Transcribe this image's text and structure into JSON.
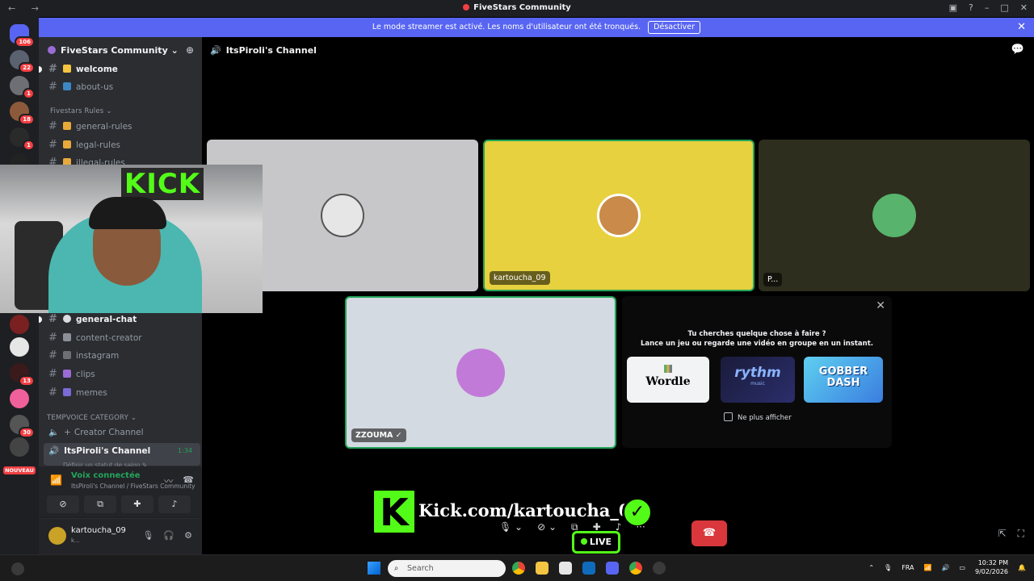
{
  "window": {
    "title": "FiveStars Community",
    "nav_arrows": "← →"
  },
  "banner": {
    "text": "Le mode streamer est activé. Les noms d'utilisateur ont été tronqués.",
    "button": "Désactiver",
    "close": "✕"
  },
  "servers": [
    {
      "badge": "106"
    },
    {
      "badge": "22"
    },
    {
      "badge": "1"
    },
    {
      "badge": "18"
    },
    {
      "badge": "1"
    },
    {
      "badge": "13"
    },
    {
      "badge": "30"
    }
  ],
  "server_new_label": "NOUVEAU",
  "guild": {
    "name": "FiveStars Community ⌄"
  },
  "channels": {
    "welcome": "welcome",
    "about_us": "about-us",
    "rules_category": "Fivestars Rules ⌄",
    "general_rules": "general-rules",
    "legal_rules": "legal-rules",
    "illegal_rules": "illegal-rules",
    "general_chat": "general-chat",
    "content_creator": "content-creator",
    "instagram": "instagram",
    "clips": "clips",
    "memes": "memes",
    "temp_category": "TEMPVOICE CATEGORY ⌄",
    "creator_channel": "Creator Channel",
    "active_voice": "ItsPiroli's Channel",
    "active_timer": "1:34",
    "active_status": "Définir un statut de salon ✎"
  },
  "voice_panel": {
    "status": "Voix connectée",
    "location": "ItsPiroli's Channel / FiveStars Community"
  },
  "user": {
    "name": "kartoucha_09",
    "status": "k..."
  },
  "header": {
    "channel": "ItsPiroli's Channel"
  },
  "tiles": {
    "tile2_name": "kartoucha_09",
    "tile3_name": "P...",
    "tile4_name": "ZZOUMA ✓"
  },
  "activity": {
    "line1": "Tu cherches quelque chose à faire ?",
    "line2": "Lance un jeu ou regarde une vidéo en groupe en un instant.",
    "wordle": "Wordle",
    "rythm": "rythm",
    "rythm_sub": "music",
    "gobber": "GOBBER DASH",
    "checkbox": "Ne plus afficher",
    "close": "✕"
  },
  "overlay": {
    "kick_letter": "K",
    "kick_cam_text": "KICK",
    "url": "Kick.com/kartoucha_09",
    "live": "LIVE"
  },
  "taskbar": {
    "search": "Search",
    "lang": "FRA",
    "time": "10:32 PM",
    "date": "9/02/2026"
  },
  "colors": {
    "blurple": "#5865f2",
    "green": "#23a55a",
    "red": "#da373c",
    "kick": "#53fc18",
    "tile_yellow": "#e7d13f"
  }
}
